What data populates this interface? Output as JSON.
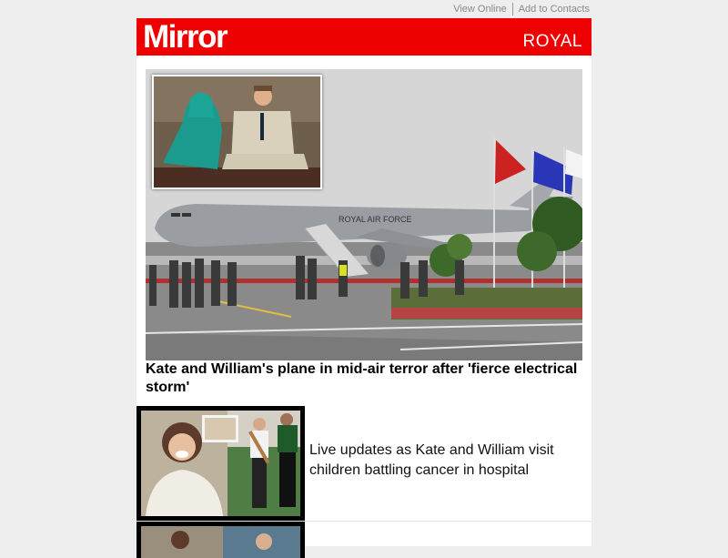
{
  "toplinks": {
    "view_online": "View Online",
    "add_contacts": "Add to Contacts"
  },
  "masthead": {
    "logo_text": "Mirror",
    "section_label": "ROYAL",
    "brand_color": "#ee0000"
  },
  "hero": {
    "headline": "Kate and William's plane in mid-air terror after 'fierce electrical storm'",
    "plane_text": "ROYAL AIR FORCE"
  },
  "stories": [
    {
      "title": "Live updates as Kate and William visit children battling cancer in hospital"
    },
    {
      "title": ""
    }
  ]
}
